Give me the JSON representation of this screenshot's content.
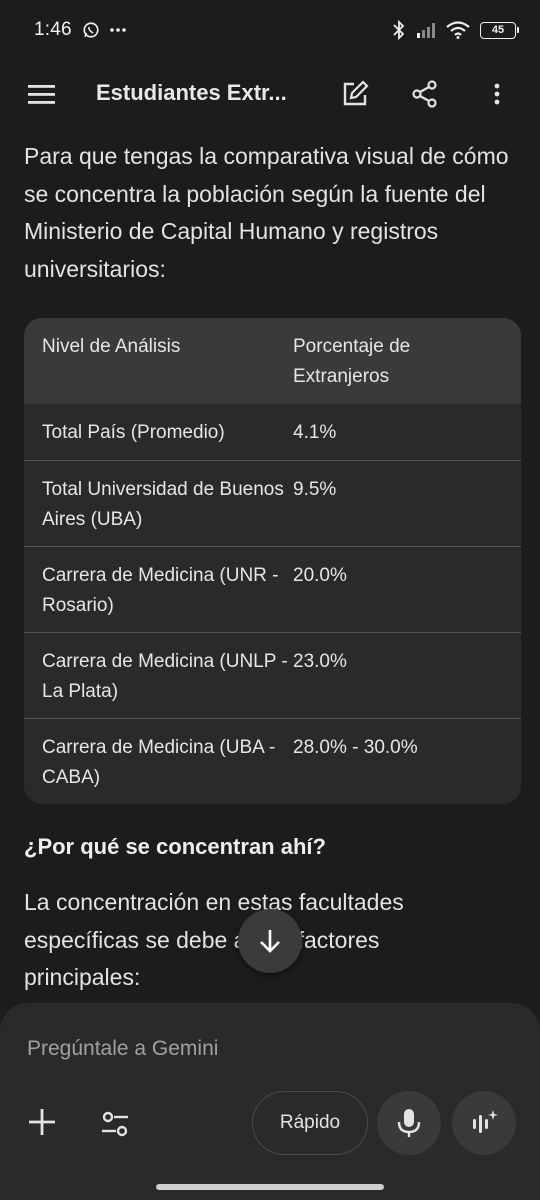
{
  "status_bar": {
    "time": "1:46",
    "battery": "45",
    "icons": [
      "whatsapp-icon",
      "more-notifications-icon",
      "bluetooth-icon",
      "signal-icon",
      "wifi-icon",
      "battery-icon"
    ]
  },
  "app_bar": {
    "title": "Estudiantes Extr...",
    "icons": [
      "menu-icon",
      "edit-icon",
      "share-icon",
      "more-vert-icon"
    ]
  },
  "content": {
    "intro": "Para que tengas la comparativa visual de cómo se concentra la población según la fuente del Ministerio de Capital Humano y registros universitarios:",
    "table": {
      "headers": [
        "Nivel de Análisis",
        "Porcentaje de Extranjeros"
      ],
      "rows": [
        {
          "level": "Total País (Promedio)",
          "percent": "4.1%"
        },
        {
          "level": "Total Universidad de Buenos Aires (UBA)",
          "percent": "9.5%"
        },
        {
          "level": "Carrera de Medicina (UNR - Rosario)",
          "percent": "20.0%"
        },
        {
          "level": "Carrera de Medicina (UNLP - La Plata)",
          "percent": "23.0%"
        },
        {
          "level": "Carrera de Medicina (UBA - CABA)",
          "percent": "28.0% - 30.0%"
        }
      ]
    },
    "section_heading": "¿Por qué se concentran ahí?",
    "paragraph": "La concentración en estas facultades específicas se debe a tres factores principales:"
  },
  "composer": {
    "placeholder": "Pregúntale a Gemini",
    "model_label": "Rápido",
    "icons": [
      "plus-icon",
      "tools-icon",
      "mic-icon",
      "live-icon",
      "arrow-down-icon"
    ]
  },
  "colors": {
    "background": "#1b1c1d",
    "table_header": "#3a3a3a",
    "table_body": "#2a2a2a",
    "text": "#e3e3e3"
  }
}
